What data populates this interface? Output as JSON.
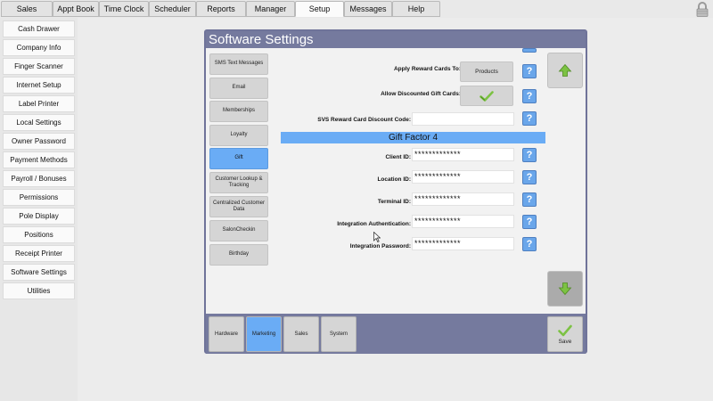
{
  "top_tabs": [
    {
      "label": "Sales",
      "active": false
    },
    {
      "label": "Appt Book",
      "active": false
    },
    {
      "label": "Time Clock",
      "active": false
    },
    {
      "label": "Scheduler",
      "active": false
    },
    {
      "label": "Reports",
      "active": false
    },
    {
      "label": "Manager",
      "active": false
    },
    {
      "label": "Setup",
      "active": true
    },
    {
      "label": "Messages",
      "active": false
    },
    {
      "label": "Help",
      "active": false
    }
  ],
  "sidebar": {
    "items": [
      {
        "label": "Cash Drawer"
      },
      {
        "label": "Company Info"
      },
      {
        "label": "Finger Scanner"
      },
      {
        "label": "Internet Setup"
      },
      {
        "label": "Label Printer"
      },
      {
        "label": "Local Settings"
      },
      {
        "label": "Owner Password"
      },
      {
        "label": "Payment Methods"
      },
      {
        "label": "Payroll / Bonuses"
      },
      {
        "label": "Permissions"
      },
      {
        "label": "Pole Display"
      },
      {
        "label": "Positions"
      },
      {
        "label": "Receipt Printer"
      },
      {
        "label": "Software Settings"
      },
      {
        "label": "Utilities"
      }
    ]
  },
  "dialog": {
    "title": "Software Settings",
    "categories": [
      {
        "label": "SMS Text Messages",
        "active": false
      },
      {
        "label": "Email",
        "active": false
      },
      {
        "label": "Memberships",
        "active": false
      },
      {
        "label": "Loyalty",
        "active": false
      },
      {
        "label": "Gift",
        "active": true
      },
      {
        "label": "Customer Lookup & Tracking",
        "active": false
      },
      {
        "label": "Centralized Customer Data",
        "active": false
      },
      {
        "label": "SalonCheckin",
        "active": false
      },
      {
        "label": "Birthday",
        "active": false
      }
    ],
    "apply_reward_cards": {
      "label": "Apply Reward Cards To:",
      "value": "Products"
    },
    "allow_discounted_gift_cards": {
      "label": "Allow Discounted Gift Cards:",
      "checked": true
    },
    "svs_discount_code": {
      "label": "SVS Reward Card Discount Code:",
      "value": ""
    },
    "section_header": "Gift Factor 4",
    "gift_factor_fields": [
      {
        "label": "Client ID:",
        "value": "*************"
      },
      {
        "label": "Location ID:",
        "value": "*************"
      },
      {
        "label": "Terminal ID:",
        "value": "*************"
      },
      {
        "label": "Integration Authentication:",
        "value": "*************"
      },
      {
        "label": "Integration Password:",
        "value": "*************"
      }
    ],
    "help_glyph": "?",
    "bottom_tabs": [
      {
        "label": "Hardware",
        "active": false
      },
      {
        "label": "Marketing",
        "active": true
      },
      {
        "label": "Sales",
        "active": false
      },
      {
        "label": "System",
        "active": false
      }
    ],
    "save_label": "Save"
  },
  "colors": {
    "accent_blue": "#6aacf5",
    "dialog_frame": "#757a9e",
    "help_blue": "#6aa6ea",
    "arrow_green": "#7cc243"
  },
  "icons": {
    "lock": "lock-icon",
    "scroll_up": "arrow-up-icon",
    "scroll_down": "arrow-down-icon",
    "check": "checkmark-icon",
    "help": "question-mark-icon"
  }
}
